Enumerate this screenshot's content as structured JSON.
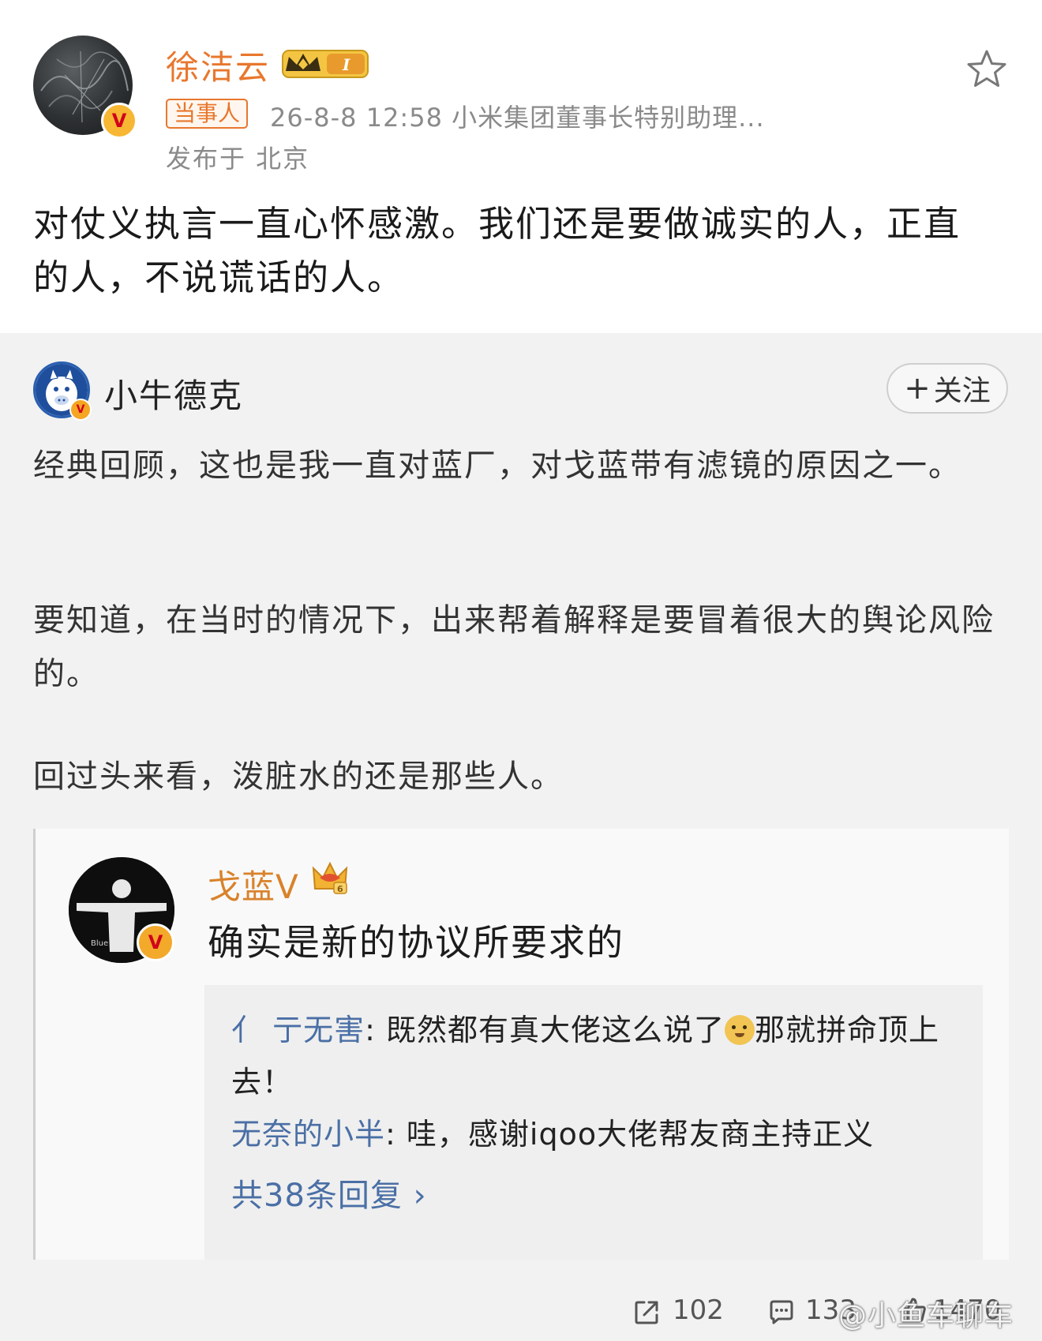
{
  "post": {
    "author_name": "徐洁云",
    "tag": "当事人",
    "meta": "26-8-8 12:58  小米集团董事长特别助理...",
    "location": "发布于 北京",
    "content": "对仗义执言一直心怀感激。我们还是要做诚实的人，正直的人，不说谎话的人。"
  },
  "repost": {
    "author_name": "小牛德克",
    "follow_label": "关注",
    "paragraph_1": "经典回顾，这也是我一直对蓝厂，对戈蓝带有滤镜的原因之一。",
    "paragraph_2": "要知道，在当时的情况下，出来帮着解释是要冒着很大的舆论风险的。",
    "paragraph_3": "回过头来看，泼脏水的还是那些人。"
  },
  "embedded": {
    "author_name": "戈蓝V",
    "comment": "确实是新的协议所要求的",
    "replies": [
      {
        "user": "亻 亍无害",
        "text_a": "既然都有真大佬这么说了",
        "text_b": "那就拼命顶上去！"
      },
      {
        "user": "无奈的小半",
        "text": "哇，感谢iqoo大佬帮友商主持正义"
      }
    ],
    "more_replies": "共38条回复 ›"
  },
  "footer": {
    "repost_count": "102",
    "comment_count": "133",
    "like_count": "1470",
    "watermark": "@小鱼车聊车"
  },
  "icons": {
    "star": "star-outline-icon",
    "repost": "repost-icon",
    "comment": "comment-icon",
    "like": "thumbs-up-icon",
    "verified": "v-verified-icon"
  },
  "colors": {
    "accent_orange": "#e8772e",
    "link_blue": "#4a6fa5",
    "badge_gold": "#f5a623"
  }
}
